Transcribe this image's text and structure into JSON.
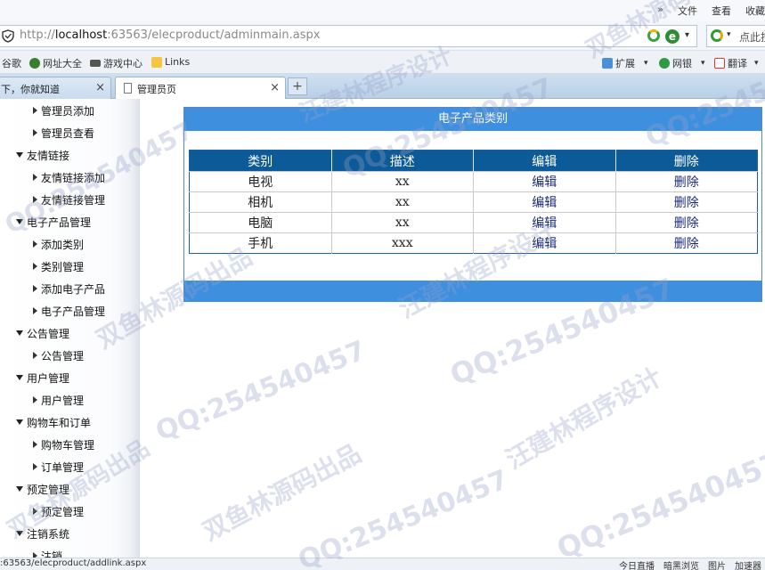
{
  "browser": {
    "menus": [
      "文件",
      "查看",
      "收藏"
    ],
    "address": {
      "prefix": "http://",
      "host": "localhost",
      "rest": ":63563/elecproduct/adminmain.aspx"
    },
    "search_placeholder": "点此搜",
    "favorites": [
      "谷歌",
      "网址大全",
      "游戏中心",
      "Links"
    ],
    "right_tools": [
      "扩展",
      "网银",
      "翻译"
    ],
    "tabs": [
      {
        "label": "下，你就知道",
        "close": "×"
      },
      {
        "label": "管理员页",
        "close": "×"
      }
    ],
    "new_tab": "+",
    "status_url": ":63563/elecproduct/addlink.aspx",
    "status_items": [
      "今日直播",
      "暗黑浏览",
      "图片",
      "加速器"
    ]
  },
  "sidebar": {
    "items": [
      {
        "type": "sub",
        "label": "管理员添加"
      },
      {
        "type": "sub",
        "label": "管理员查看"
      },
      {
        "type": "head",
        "label": "友情链接"
      },
      {
        "type": "sub",
        "label": "友情链接添加"
      },
      {
        "type": "sub",
        "label": "友情链接管理"
      },
      {
        "type": "head",
        "label": "电子产品管理"
      },
      {
        "type": "sub",
        "label": "添加类别"
      },
      {
        "type": "sub",
        "label": "类别管理"
      },
      {
        "type": "sub",
        "label": "添加电子产品"
      },
      {
        "type": "sub",
        "label": "电子产品管理"
      },
      {
        "type": "head",
        "label": "公告管理"
      },
      {
        "type": "sub",
        "label": "公告管理"
      },
      {
        "type": "head",
        "label": "用户管理"
      },
      {
        "type": "sub",
        "label": "用户管理"
      },
      {
        "type": "head",
        "label": "购物车和订单"
      },
      {
        "type": "sub",
        "label": "购物车管理"
      },
      {
        "type": "sub",
        "label": "订单管理"
      },
      {
        "type": "head",
        "label": "预定管理"
      },
      {
        "type": "sub",
        "label": "预定管理"
      },
      {
        "type": "head",
        "label": "注销系统"
      },
      {
        "type": "sub",
        "label": "注销"
      }
    ]
  },
  "main": {
    "title": "电子产品类别",
    "columns": [
      "类别",
      "描述",
      "编辑",
      "删除"
    ],
    "rows": [
      {
        "category": "电视",
        "desc": "xx",
        "edit": "编辑",
        "delete": "删除"
      },
      {
        "category": "相机",
        "desc": "xx",
        "edit": "编辑",
        "delete": "删除"
      },
      {
        "category": "电脑",
        "desc": "xx",
        "edit": "编辑",
        "delete": "删除"
      },
      {
        "category": "手机",
        "desc": "xxx",
        "edit": "编辑",
        "delete": "删除"
      }
    ]
  },
  "watermarks": [
    "双鱼林源码出品",
    "汪建林程序设计",
    "QQ:254540457"
  ],
  "colors": {
    "panel_header": "#3f8fdf",
    "table_header": "#0c5a97",
    "link": "#1c2a78"
  }
}
